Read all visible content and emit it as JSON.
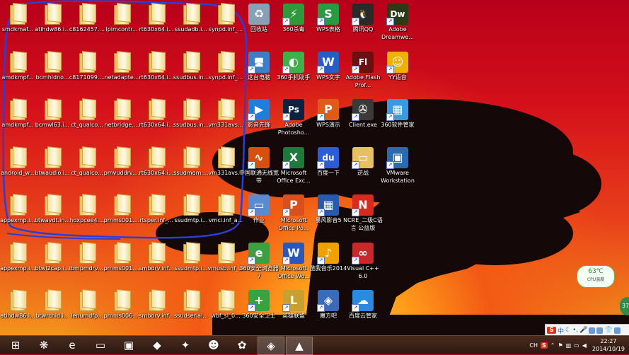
{
  "desktop": {
    "files": [
      {
        "label": "smdkmaf...",
        "col": 0,
        "row": 0
      },
      {
        "label": "atihdw86.i...",
        "col": 1,
        "row": 0
      },
      {
        "label": "c8162457....",
        "col": 2,
        "row": 0
      },
      {
        "label": "lpimcontr...",
        "col": 3,
        "row": 0
      },
      {
        "label": "rt630x64.i...",
        "col": 4,
        "row": 0
      },
      {
        "label": "ssudadb.i...",
        "col": 5,
        "row": 0
      },
      {
        "label": "synpd.inf_...",
        "col": 6,
        "row": 0
      },
      {
        "label": "amdkmpf...",
        "col": 0,
        "row": 1
      },
      {
        "label": "bcmhidno...",
        "col": 1,
        "row": 1
      },
      {
        "label": "c8171099....",
        "col": 2,
        "row": 1
      },
      {
        "label": "netadapte...",
        "col": 3,
        "row": 1
      },
      {
        "label": "rt630x64.i...",
        "col": 4,
        "row": 1
      },
      {
        "label": "ssudbus.in...",
        "col": 5,
        "row": 1
      },
      {
        "label": "synpd.inf_...",
        "col": 6,
        "row": 1
      },
      {
        "label": "amdkmpf...",
        "col": 0,
        "row": 2
      },
      {
        "label": "bcmwl63.i...",
        "col": 1,
        "row": 2
      },
      {
        "label": "ct_qualco...",
        "col": 2,
        "row": 2
      },
      {
        "label": "netbridge....",
        "col": 3,
        "row": 2
      },
      {
        "label": "rt630x64.i...",
        "col": 4,
        "row": 2
      },
      {
        "label": "ssudbus.in...",
        "col": 5,
        "row": 2
      },
      {
        "label": "vm331avs...",
        "col": 6,
        "row": 2
      },
      {
        "label": "android_w...",
        "col": 0,
        "row": 3
      },
      {
        "label": "btwaudio.i...",
        "col": 1,
        "row": 3
      },
      {
        "label": "ct_qualco...",
        "col": 2,
        "row": 3
      },
      {
        "label": "pmvuddrv....",
        "col": 3,
        "row": 3
      },
      {
        "label": "rt630x64.i...",
        "col": 4,
        "row": 3
      },
      {
        "label": "ssudmdm....",
        "col": 5,
        "row": 3
      },
      {
        "label": "vm331avs...",
        "col": 6,
        "row": 3
      },
      {
        "label": "appexmp.i...",
        "col": 0,
        "row": 4
      },
      {
        "label": "btwavdt.in...",
        "col": 1,
        "row": 4
      },
      {
        "label": "hdxpcee4....",
        "col": 2,
        "row": 4
      },
      {
        "label": "prnms001....",
        "col": 3,
        "row": 4
      },
      {
        "label": "rtsper.inf_...",
        "col": 4,
        "row": 4
      },
      {
        "label": "ssudmtp.i...",
        "col": 5,
        "row": 4
      },
      {
        "label": "vmci.inf_a...",
        "col": 6,
        "row": 4
      },
      {
        "label": "appexmp.i...",
        "col": 0,
        "row": 5
      },
      {
        "label": "btwl2cap.i...",
        "col": 1,
        "row": 5
      },
      {
        "label": "ibmpmdrv....",
        "col": 2,
        "row": 5
      },
      {
        "label": "prnms001....",
        "col": 3,
        "row": 5
      },
      {
        "label": "smbdrv.inf...",
        "col": 4,
        "row": 5
      },
      {
        "label": "ssudmtp.i...",
        "col": 5,
        "row": 5
      },
      {
        "label": "vmusb.inf_...",
        "col": 6,
        "row": 5
      },
      {
        "label": "atihdw86.i...",
        "col": 0,
        "row": 6
      },
      {
        "label": "btwrchid.i...",
        "col": 1,
        "row": 6
      },
      {
        "label": "lenumdfp...",
        "col": 2,
        "row": 6
      },
      {
        "label": "prnms006....",
        "col": 3,
        "row": 6
      },
      {
        "label": "smbdrv.inf...",
        "col": 4,
        "row": 6
      },
      {
        "label": "ssudserial...",
        "col": 5,
        "row": 6
      },
      {
        "label": "wbf_sl_0...",
        "col": 6,
        "row": 6
      }
    ],
    "apps": [
      {
        "label": "回收站",
        "col": 0,
        "row": 0,
        "icon": "recycle-bin-icon",
        "color": "#8aa0b4",
        "glyph": "♻"
      },
      {
        "label": "360杀毒",
        "col": 1,
        "row": 0,
        "icon": "360-antivirus-icon",
        "color": "#2e9a3c",
        "glyph": "⚡"
      },
      {
        "label": "WPS表格",
        "col": 2,
        "row": 0,
        "icon": "wps-sheet-icon",
        "color": "#2a9a42",
        "glyph": "S"
      },
      {
        "label": "腾讯QQ",
        "col": 3,
        "row": 0,
        "icon": "qq-penguin-icon",
        "color": "#2a2a2a",
        "glyph": "🐧"
      },
      {
        "label": "Adobe Dreamwe...",
        "col": 4,
        "row": 0,
        "icon": "dreamweaver-icon",
        "color": "#2d3a17",
        "glyph": "Dw"
      },
      {
        "label": "这台电脑",
        "col": 0,
        "row": 1,
        "icon": "this-pc-icon",
        "color": "#3a7fc8",
        "glyph": "🖥"
      },
      {
        "label": "360手机助手",
        "col": 1,
        "row": 1,
        "icon": "360-phone-assistant-icon",
        "color": "#3fb04a",
        "glyph": "◐"
      },
      {
        "label": "WPS文字",
        "col": 2,
        "row": 1,
        "icon": "wps-writer-icon",
        "color": "#2a5cc8",
        "glyph": "W"
      },
      {
        "label": "Adobe Flash Prof...",
        "col": 3,
        "row": 1,
        "icon": "flash-icon",
        "color": "#6a1010",
        "glyph": "Fl"
      },
      {
        "label": "YY语音",
        "col": 4,
        "row": 1,
        "icon": "yy-voice-icon",
        "color": "#f0b000",
        "glyph": "☺"
      },
      {
        "label": "影音先锋",
        "col": 0,
        "row": 2,
        "icon": "media-player-icon",
        "color": "#1e7fd8",
        "glyph": "▶"
      },
      {
        "label": "Adobe Photosho...",
        "col": 1,
        "row": 2,
        "icon": "photoshop-icon",
        "color": "#0c2240",
        "glyph": "Ps"
      },
      {
        "label": "WPS演示",
        "col": 2,
        "row": 2,
        "icon": "wps-presentation-icon",
        "color": "#e05a18",
        "glyph": "P"
      },
      {
        "label": "Client.exe",
        "col": 3,
        "row": 2,
        "icon": "client-exe-icon",
        "color": "#3a3a3a",
        "glyph": "✇"
      },
      {
        "label": "360软件管家",
        "col": 4,
        "row": 2,
        "icon": "360-software-manager-icon",
        "color": "#3a9ae0",
        "glyph": "▦"
      },
      {
        "label": "中国联通无线宽带",
        "col": 0,
        "row": 3,
        "icon": "china-unicom-icon",
        "color": "#d85010",
        "glyph": "∿"
      },
      {
        "label": "Microsoft Office Exc...",
        "col": 1,
        "row": 3,
        "icon": "excel-icon",
        "color": "#1e7a3a",
        "glyph": "X"
      },
      {
        "label": "百度一下",
        "col": 2,
        "row": 3,
        "icon": "baidu-icon",
        "color": "#2a5ed8",
        "glyph": "du"
      },
      {
        "label": "逆战",
        "col": 3,
        "row": 3,
        "icon": "nizhan-folder-icon",
        "color": "#e8c060",
        "glyph": "▭"
      },
      {
        "label": "VMware Workstation",
        "col": 4,
        "row": 3,
        "icon": "vmware-icon",
        "color": "#2a6ab0",
        "glyph": "▣"
      },
      {
        "label": "作业",
        "col": 0,
        "row": 4,
        "icon": "homework-icon",
        "color": "#5a8ad0",
        "glyph": "▭"
      },
      {
        "label": "Microsoft Office Po...",
        "col": 1,
        "row": 4,
        "icon": "powerpoint-icon",
        "color": "#d8501e",
        "glyph": "P"
      },
      {
        "label": "暴风影音5",
        "col": 2,
        "row": 4,
        "icon": "baofeng-icon",
        "color": "#2a5ab0",
        "glyph": "▦"
      },
      {
        "label": "NCRE_二级C语言 公益版",
        "col": 3,
        "row": 4,
        "icon": "ncre-icon",
        "color": "#d82a1e",
        "glyph": "N"
      },
      {
        "label": "360安全浏览器7",
        "col": 0,
        "row": 5,
        "icon": "360-browser-icon",
        "color": "#3aa040",
        "glyph": "e"
      },
      {
        "label": "Microsoft Office Wo...",
        "col": 1,
        "row": 5,
        "icon": "word-icon",
        "color": "#2a58b8",
        "glyph": "W"
      },
      {
        "label": "酷我音乐2014",
        "col": 2,
        "row": 5,
        "icon": "kuwo-music-icon",
        "color": "#f0a000",
        "glyph": "♪"
      },
      {
        "label": "Visual C++ 6.0",
        "col": 3,
        "row": 5,
        "icon": "visual-cpp-icon",
        "color": "#c8282a",
        "glyph": "∞"
      },
      {
        "label": "360安全卫士",
        "col": 0,
        "row": 6,
        "icon": "360-safe-guard-icon",
        "color": "#3aa040",
        "glyph": "+"
      },
      {
        "label": "英雄联盟",
        "col": 1,
        "row": 6,
        "icon": "league-of-legends-icon",
        "color": "#c8a030",
        "glyph": "L"
      },
      {
        "label": "魔方吧",
        "col": 2,
        "row": 6,
        "icon": "mofang-icon",
        "color": "#3a6ab8",
        "glyph": "◈"
      },
      {
        "label": "百度云管家",
        "col": 3,
        "row": 6,
        "icon": "baidu-cloud-icon",
        "color": "#2a8ae0",
        "glyph": "☁"
      }
    ]
  },
  "gadget": {
    "temp": "63℃",
    "label": "CPU温度"
  },
  "side_ball": "37",
  "ime": {
    "logo": "S",
    "mode": "中"
  },
  "taskbar": {
    "items": [
      {
        "name": "start-button",
        "glyph": "⊞"
      },
      {
        "name": "taskbar-app-picasa",
        "glyph": "❋"
      },
      {
        "name": "taskbar-app-ie",
        "glyph": "e"
      },
      {
        "name": "taskbar-app-explorer",
        "glyph": "▭"
      },
      {
        "name": "taskbar-app-store",
        "glyph": "▣"
      },
      {
        "name": "taskbar-app-skype-shell",
        "glyph": "◆"
      },
      {
        "name": "taskbar-app-bee",
        "glyph": "✦"
      },
      {
        "name": "taskbar-app-qq",
        "glyph": "☻"
      },
      {
        "name": "taskbar-app-baidu",
        "glyph": "✿"
      },
      {
        "name": "taskbar-app-mofang",
        "glyph": "◈"
      },
      {
        "name": "taskbar-app-screenshot",
        "glyph": "▲"
      }
    ],
    "tray": {
      "lang": "CH",
      "ime": "S",
      "time": "22:27",
      "date": "2014/10/19"
    }
  }
}
